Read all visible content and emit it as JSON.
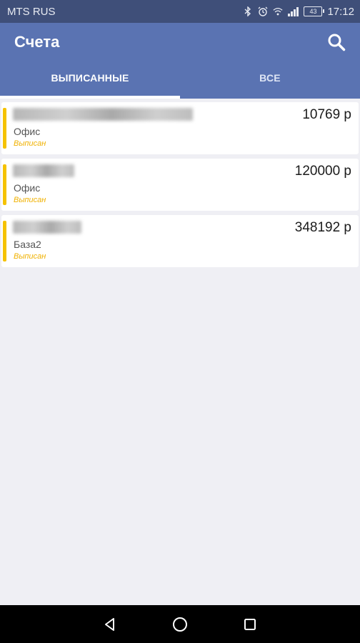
{
  "status_bar": {
    "carrier": "MTS RUS",
    "battery": "43",
    "time": "17:12",
    "icons": [
      "bluetooth-icon",
      "alarm-icon",
      "wifi-icon",
      "signal-icon",
      "battery-icon"
    ]
  },
  "app_bar": {
    "title": "Счета",
    "accent_color": "#5a73b2",
    "search_icon": "search-icon"
  },
  "tabs": [
    {
      "label": "ВЫПИСАННЫЕ",
      "selected": true
    },
    {
      "label": "ВСЕ",
      "selected": false
    }
  ],
  "invoices": [
    {
      "client": "",
      "amount": "10769 р",
      "department": "Офис",
      "status": "Выписан"
    },
    {
      "client": "",
      "amount": "120000 р",
      "department": "Офис",
      "status": "Выписан"
    },
    {
      "client": "",
      "amount": "348192 р",
      "department": "База2",
      "status": "Выписан"
    }
  ],
  "status_color": "#f5c200",
  "nav_bar": {
    "icons": [
      "back-icon",
      "home-icon",
      "recents-icon"
    ]
  }
}
